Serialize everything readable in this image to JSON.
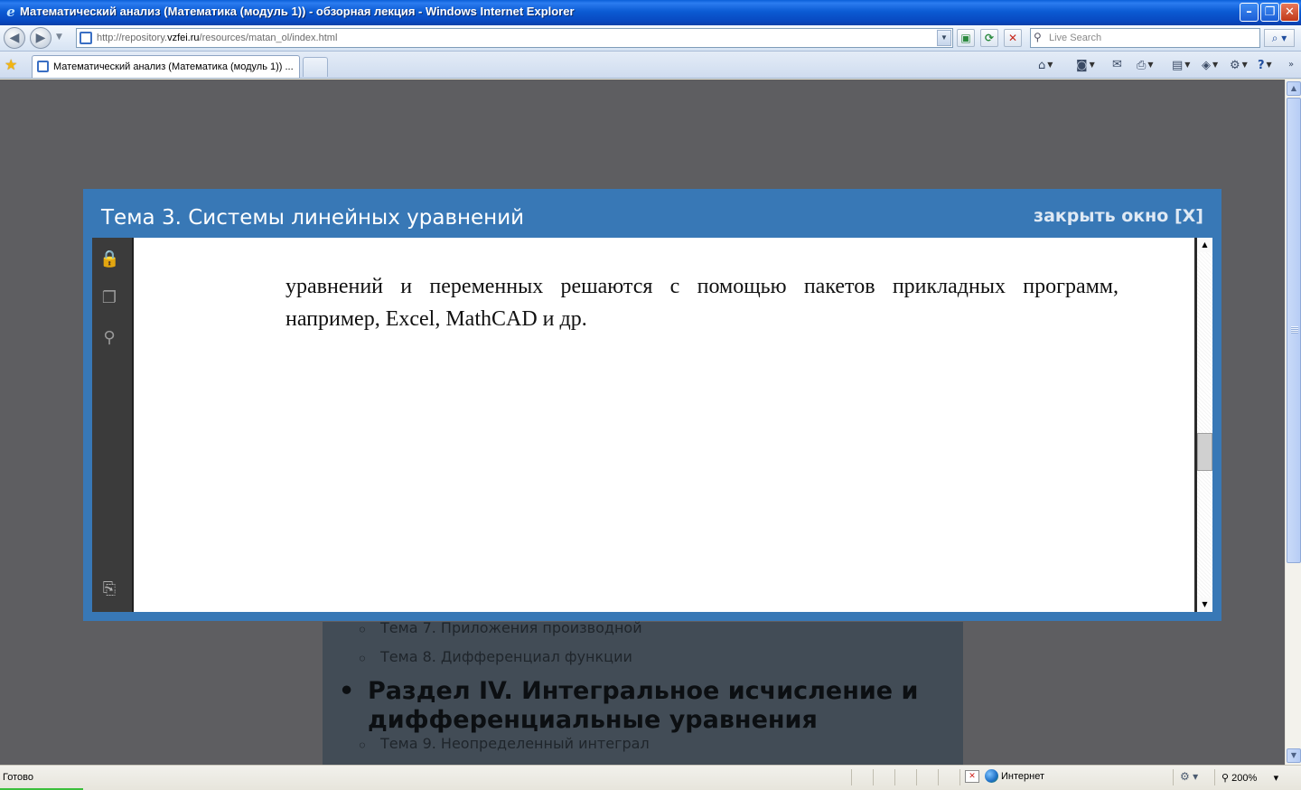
{
  "window": {
    "title": "Математический анализ (Математика (модуль 1)) - обзорная лекция - Windows Internet Explorer",
    "minimize_label": "–",
    "restore_label": "❐",
    "close_label": "✕"
  },
  "navbar": {
    "back_glyph": "◀",
    "forward_glyph": "▶",
    "address_prefix": "http://repository.",
    "address_domain": "vzfei.ru",
    "address_path": "/resources/matan_ol/index.html",
    "refresh_glyph": "⟳",
    "stop_glyph": "✕",
    "compat_glyph": "▣",
    "search_placeholder": "Live Search",
    "search_glyph": "⌕"
  },
  "tabs": {
    "active_label": "Математический анализ (Математика (модуль 1)) ...",
    "commands": {
      "home_glyph": "⌂",
      "feeds_glyph": "◙",
      "mail_glyph": "✉",
      "print_glyph": "⎙",
      "page_glyph": "▤",
      "safety_glyph": "◈",
      "tools_glyph": "⚙",
      "help_glyph": "?"
    }
  },
  "background_page": {
    "items": [
      {
        "kind": "topic",
        "text": "Тема 7. Приложения производной"
      },
      {
        "kind": "topic",
        "text": "Тема 8. Дифференциал функции"
      },
      {
        "kind": "section",
        "text": "Раздел IV. Интегральное исчисление и дифференциальные уравнения"
      },
      {
        "kind": "topic",
        "text": "Тема 9. Неопределенный интеграл"
      }
    ]
  },
  "modal": {
    "title": "Тема 3. Системы линейных уравнений",
    "close_label": "закрыть окно [X]",
    "document_text": "уравнений и переменных решаются с помощью пакетов прикладных программ, например, Excel, MathCAD и др."
  },
  "reader_tools": {
    "lock_glyph": "🔒",
    "pages_glyph": "❐",
    "find_glyph": "⚲",
    "attach_glyph": "⎘"
  },
  "statusbar": {
    "status_text": "Готово",
    "zone_label": "Интернет",
    "zoom_label": "200%"
  }
}
